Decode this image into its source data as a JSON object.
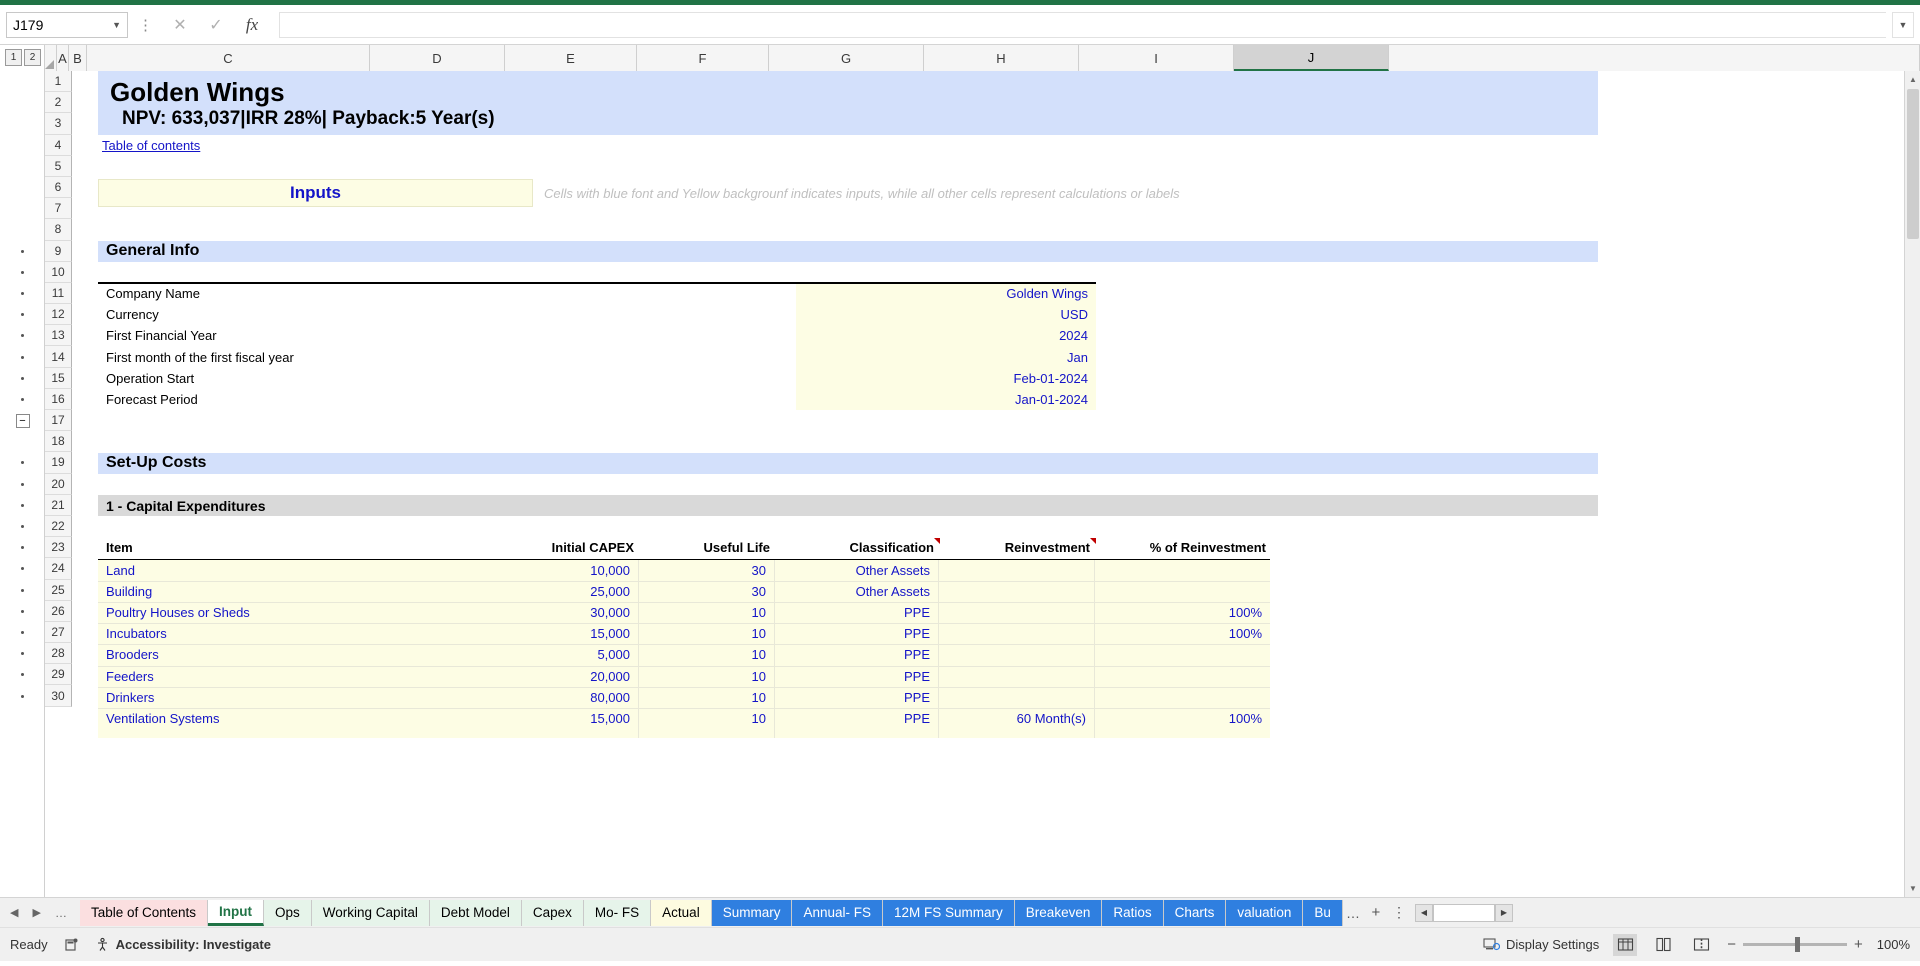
{
  "formula_bar": {
    "name_box": "J179",
    "formula_value": "",
    "cancel_icon": "close-icon",
    "confirm_icon": "check-icon",
    "fx_label": "fx"
  },
  "outline": {
    "level1": "1",
    "level2": "2"
  },
  "columns": [
    "A",
    "B",
    "C",
    "D",
    "E",
    "F",
    "G",
    "H",
    "I",
    "J"
  ],
  "selected_column": "J",
  "rows": [
    "1",
    "2",
    "3",
    "4",
    "5",
    "6",
    "7",
    "8",
    "9",
    "10",
    "11",
    "12",
    "13",
    "14",
    "15",
    "16",
    "17",
    "18",
    "19",
    "20",
    "21",
    "22",
    "23",
    "24",
    "25",
    "26",
    "27",
    "28",
    "29",
    "30"
  ],
  "sheet": {
    "company_title": "Golden Wings",
    "metrics_line": "NPV: 633,037|IRR 28%| Payback:5 Year(s)",
    "toc_link": "Table of contents",
    "inputs_label": "Inputs",
    "inputs_note": "Cells with blue font and Yellow backgrounf indicates inputs, while all other cells represent calculations or labels",
    "general_info_header": "General Info",
    "general_info": [
      {
        "label": "Company Name",
        "value": "Golden Wings"
      },
      {
        "label": "Currency",
        "value": "USD"
      },
      {
        "label": "First Financial Year",
        "value": "2024"
      },
      {
        "label": "First month of the first fiscal year",
        "value": "Jan"
      },
      {
        "label": "Operation Start",
        "value": "Feb-01-2024"
      },
      {
        "label": "Forecast Period",
        "value": "Jan-01-2024"
      }
    ],
    "setup_costs_header": "Set-Up Costs",
    "capex_subsection": "1 - Capital Expenditures",
    "capex_headers": {
      "item": "Item",
      "initial_capex": "Initial CAPEX",
      "useful_life": "Useful Life",
      "classification": "Classification",
      "reinvestment": "Reinvestment",
      "pct_reinvestment": "% of Reinvestment"
    },
    "capex_rows": [
      {
        "item": "Land",
        "initial_capex": "10,000",
        "useful_life": "30",
        "classification": "Other Assets",
        "reinvestment": "",
        "pct_reinvestment": ""
      },
      {
        "item": "Building",
        "initial_capex": "25,000",
        "useful_life": "30",
        "classification": "Other Assets",
        "reinvestment": "",
        "pct_reinvestment": ""
      },
      {
        "item": "Poultry Houses or Sheds",
        "initial_capex": "30,000",
        "useful_life": "10",
        "classification": "PPE",
        "reinvestment": "",
        "pct_reinvestment": "100%"
      },
      {
        "item": "Incubators",
        "initial_capex": "15,000",
        "useful_life": "10",
        "classification": "PPE",
        "reinvestment": "",
        "pct_reinvestment": "100%"
      },
      {
        "item": "Brooders",
        "initial_capex": "5,000",
        "useful_life": "10",
        "classification": "PPE",
        "reinvestment": "",
        "pct_reinvestment": ""
      },
      {
        "item": "Feeders",
        "initial_capex": "20,000",
        "useful_life": "10",
        "classification": "PPE",
        "reinvestment": "",
        "pct_reinvestment": ""
      },
      {
        "item": "Drinkers",
        "initial_capex": "80,000",
        "useful_life": "10",
        "classification": "PPE",
        "reinvestment": "",
        "pct_reinvestment": ""
      },
      {
        "item": "Ventilation Systems",
        "initial_capex": "15,000",
        "useful_life": "10",
        "classification": "PPE",
        "reinvestment": "60 Month(s)",
        "pct_reinvestment": "100%"
      }
    ]
  },
  "tabs": [
    {
      "label": "Table of Contents",
      "style": "toc"
    },
    {
      "label": "Input",
      "style": "active"
    },
    {
      "label": "Ops",
      "style": "green"
    },
    {
      "label": "Working Capital",
      "style": "green"
    },
    {
      "label": "Debt Model",
      "style": "green"
    },
    {
      "label": "Capex",
      "style": "green"
    },
    {
      "label": "Mo- FS",
      "style": "green"
    },
    {
      "label": "Actual",
      "style": "yellowtab"
    },
    {
      "label": "Summary",
      "style": "bluetab"
    },
    {
      "label": "Annual- FS",
      "style": "bluetab"
    },
    {
      "label": "12M FS Summary",
      "style": "bluetab"
    },
    {
      "label": "Breakeven",
      "style": "bluetab"
    },
    {
      "label": "Ratios",
      "style": "bluetab"
    },
    {
      "label": "Charts",
      "style": "bluetab"
    },
    {
      "label": "valuation",
      "style": "bluetab"
    },
    {
      "label": "Bu",
      "style": "truncated"
    }
  ],
  "tab_controls": {
    "prev": "◀",
    "next": "▶",
    "more": "…",
    "overflow": "…",
    "add_sheet": "+",
    "options": "⋮"
  },
  "status_bar": {
    "ready": "Ready",
    "macro_icon": "record-macro-icon",
    "accessibility": "Accessibility: Investigate",
    "display_settings": "Display Settings",
    "normal_view_icon": "normal-view-icon",
    "page_layout_icon": "page-layout-icon",
    "page_break_icon": "page-break-preview-icon",
    "zoom_out": "−",
    "zoom_in": "+",
    "zoom_level": "100%"
  },
  "colors": {
    "excel_green": "#217346",
    "header_blue": "#d3e0fb",
    "input_yellow": "#fdfde4",
    "input_font_blue": "#1414c8",
    "section_grey": "#d9d9d9",
    "tab_blue": "#2f7fe0"
  }
}
